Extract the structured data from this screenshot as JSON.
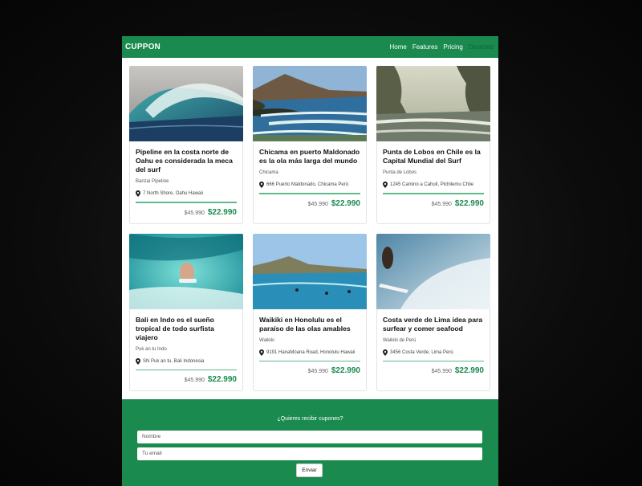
{
  "navbar": {
    "brand": "CUPPON",
    "links": [
      "Home",
      "Features",
      "Pricing",
      "Disabled"
    ]
  },
  "cards": [
    {
      "title": "Pipeline en la costa norte de Oahu es considerada la meca del surf",
      "subtitle": "Banzai Pipeline",
      "address": "7 North Shore, Oahu Hawaii",
      "old_price": "$45.990",
      "price": "$22.990",
      "image": "wave-tube"
    },
    {
      "title": "Chicama en puerto Maldonado es la ola más larga del mundo",
      "subtitle": "Chicama",
      "address": "666 Puerto Maldonado, Chicama Perú",
      "old_price": "$45.990",
      "price": "$22.990",
      "image": "coast-headland"
    },
    {
      "title": "Punta de Lobos en Chile es la Capital Mundial del Surf",
      "subtitle": "Punta de Lobos",
      "address": "1245 Camino a Cahuil, Pichilemu Chile",
      "old_price": "$45.990",
      "price": "$22.990",
      "image": "rock-arch"
    },
    {
      "title": "Bali en Indo es el sueño tropical de todo surfista viajero",
      "subtitle": "Puk an tu Indo",
      "address": "SN Puk an tu, Bali Indonesia",
      "old_price": "$45.990",
      "price": "$22.990",
      "image": "surfer-barrel"
    },
    {
      "title": "Waikiki en Honolulu es el paraíso de las olas amables",
      "subtitle": "Waikiki",
      "address": "9191 HanaMoana Road, Honolulu Hawaii",
      "old_price": "$45.990",
      "price": "$22.990",
      "image": "waikiki-bay"
    },
    {
      "title": "Costa verde de Lima idea para surfear y comer seafood",
      "subtitle": "Waikiki de Perú",
      "address": "3456 Costa Verde, Lima Perú",
      "old_price": "$45.990",
      "price": "$22.990",
      "image": "surfer-spray"
    }
  ],
  "footer": {
    "title": "¿Quieres recibir cupones?",
    "name_placeholder": "Nombre",
    "email_placeholder": "Tu email",
    "submit_label": "Enviar"
  },
  "colors": {
    "brand_green": "#1a8a4f",
    "price_green": "#1a8a4f",
    "divider_green": "#5fb98a"
  }
}
